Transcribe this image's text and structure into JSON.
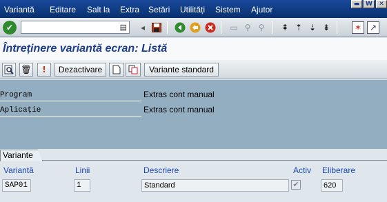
{
  "menu": {
    "items": [
      "Variantă",
      "Editare",
      "Salt la",
      "Extra",
      "Setări",
      "Utilități",
      "Sistem",
      "Ajutor"
    ]
  },
  "window_buttons": [
    "▬",
    "W",
    "✕"
  ],
  "stdbar": {
    "command_value": "",
    "icons": [
      "enter-icon",
      "save-icon",
      "back-icon",
      "exit-icon",
      "cancel-icon",
      "print-icon",
      "find-icon",
      "find-next-icon",
      "first-page-icon",
      "prev-page-icon",
      "next-page-icon",
      "last-page-icon",
      "create-session-icon",
      "shortcut-icon"
    ]
  },
  "title": "Întreținere variantă ecran: Listă",
  "appbar": {
    "deactivate_label": "Dezactivare",
    "standard_variants_label": "Variante standard"
  },
  "header": {
    "program_label": "Program",
    "program_value": "Extras cont manual",
    "application_label": "Aplicație",
    "application_value": "Extras cont manual"
  },
  "tab": {
    "label": "Variante"
  },
  "table": {
    "columns": [
      "Variantă",
      "Linii",
      "Descriere",
      "Activ",
      "Eliberare"
    ],
    "rows": [
      {
        "variant": "SAP01",
        "lines": "1",
        "description": "Standard",
        "active": true,
        "release": "620"
      }
    ]
  },
  "colors": {
    "menubar": "#0d3a85",
    "title": "#1b3b8c",
    "header_area": "#93aec1",
    "column_header": "#1a46b0"
  }
}
